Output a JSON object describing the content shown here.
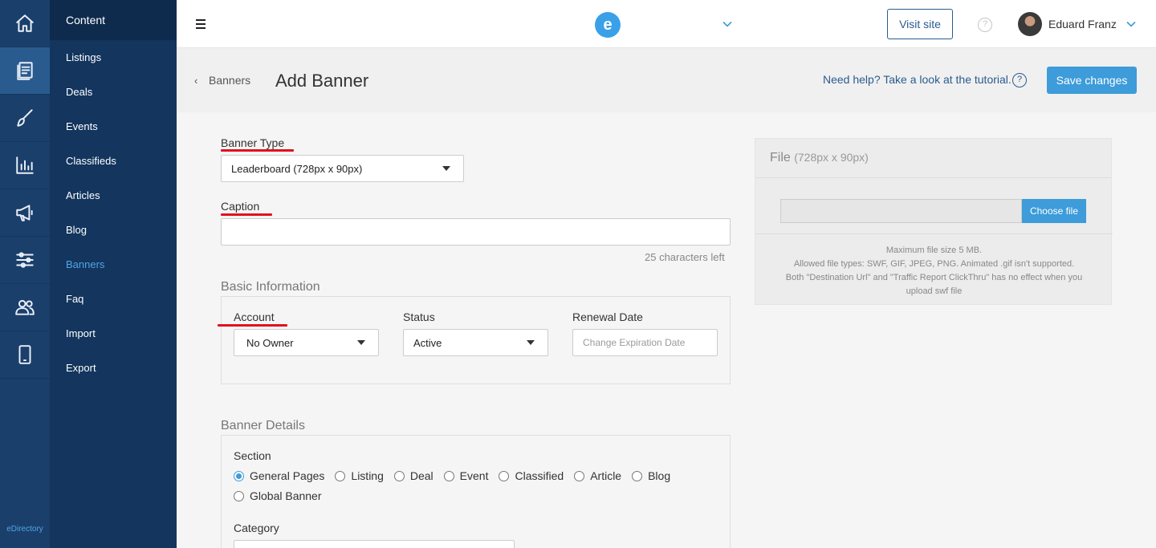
{
  "brand": {
    "rail_label": "eDirectory",
    "logo_letter": "e"
  },
  "rail": {
    "items": [
      {
        "icon": "home-icon"
      },
      {
        "icon": "content-icon",
        "active": true
      },
      {
        "icon": "brush-icon"
      },
      {
        "icon": "reports-icon"
      },
      {
        "icon": "promote-icon"
      },
      {
        "icon": "settings-icon"
      },
      {
        "icon": "users-icon"
      },
      {
        "icon": "mobile-icon"
      }
    ]
  },
  "subnav": {
    "header": "Content",
    "items": [
      {
        "label": "Listings"
      },
      {
        "label": "Deals"
      },
      {
        "label": "Events"
      },
      {
        "label": "Classifieds"
      },
      {
        "label": "Articles"
      },
      {
        "label": "Blog"
      },
      {
        "label": "Banners",
        "active": true
      },
      {
        "label": "Faq"
      },
      {
        "label": "Import"
      },
      {
        "label": "Export"
      }
    ]
  },
  "topbar": {
    "visit_site": "Visit site",
    "help_glyph": "?",
    "user_name": "Eduard Franz"
  },
  "header": {
    "back_glyph": "‹",
    "breadcrumb": "Banners",
    "title": "Add Banner",
    "tutorial": "Need help? Take a look at the tutorial.",
    "help_glyph": "?",
    "save": "Save changes"
  },
  "form": {
    "banner_type": {
      "label": "Banner Type",
      "value": "Leaderboard (728px x 90px)"
    },
    "caption": {
      "label": "Caption",
      "value": "",
      "hint": "25 characters left"
    },
    "basic": {
      "title": "Basic Information",
      "account": {
        "label": "Account",
        "value": "No Owner"
      },
      "status": {
        "label": "Status",
        "value": "Active"
      },
      "renewal": {
        "label": "Renewal Date",
        "placeholder": "Change Expiration Date"
      }
    },
    "details": {
      "title": "Banner Details",
      "section_label": "Section",
      "sections": [
        {
          "label": "General Pages",
          "checked": true
        },
        {
          "label": "Listing"
        },
        {
          "label": "Deal"
        },
        {
          "label": "Event"
        },
        {
          "label": "Classified"
        },
        {
          "label": "Article"
        },
        {
          "label": "Blog"
        },
        {
          "label": "Global Banner"
        }
      ],
      "category_label": "Category"
    }
  },
  "file": {
    "title": "File",
    "size": "(728px x 90px)",
    "choose": "Choose file",
    "notes": [
      "Maximum file size 5 MB.",
      "Allowed file types: SWF, GIF, JPEG, PNG. Animated .gif isn't supported.",
      "Both \"Destination Url\" and \"Traffic Report ClickThru\" has no effect when you upload swf file"
    ]
  },
  "colors": {
    "rail": "#1b3f6b",
    "subnav": "#13355e",
    "accent": "#3d9cd9",
    "link": "#2a5b8f",
    "annotation": "#e1111e"
  }
}
